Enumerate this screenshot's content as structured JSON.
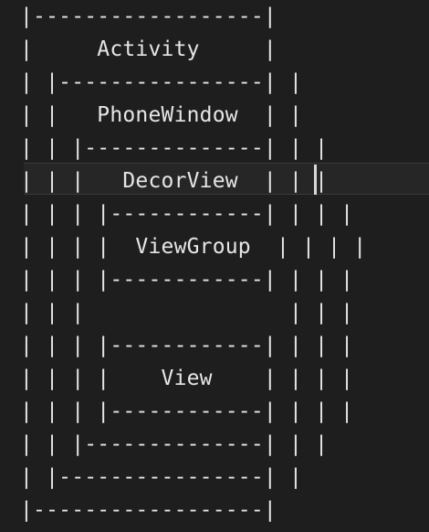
{
  "editor": {
    "lines": [
      "|------------------|",
      "|     Activity     |",
      "| |----------------| |",
      "| |   PhoneWindow  | |",
      "| | |--------------| | |",
      "| | |   DecorView  | | |",
      "| | | |------------| | | |",
      "| | | |  ViewGroup  | | | |",
      "| | | |------------| | | |",
      "| | |                | | |",
      "| | | |------------| | | |",
      "| | | |    View    | | | |",
      "| | | |------------| | | |",
      "| | |--------------| | |",
      "| |----------------| |",
      "|------------------|"
    ]
  }
}
